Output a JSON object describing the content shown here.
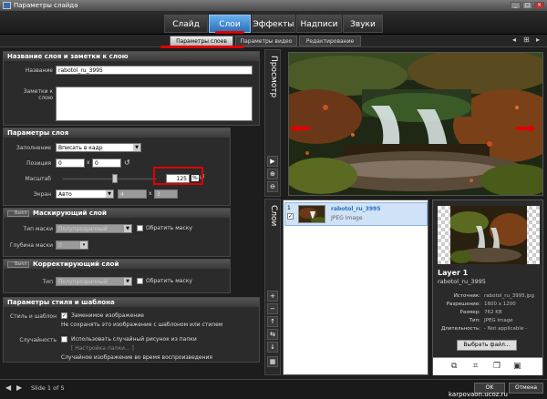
{
  "window": {
    "title": "Параметры слайда",
    "minimize_glyph": "_",
    "maximize_glyph": "□",
    "close_glyph": "×"
  },
  "main_tabs": [
    {
      "label": "Слайд"
    },
    {
      "label": "Слои"
    },
    {
      "label": "Эффекты"
    },
    {
      "label": "Надписи"
    },
    {
      "label": "Звуки"
    }
  ],
  "active_main_tab": "Слои",
  "sub_tabs": [
    {
      "label": "Параметры слоев"
    },
    {
      "label": "Параметры видео"
    },
    {
      "label": "Редактирование"
    }
  ],
  "layer_name": {
    "header": "Название слоя и заметки к слою",
    "name_label": "Название",
    "name_value": "rabotol_ru_3995",
    "notes_label": "Заметки к слою",
    "notes_value": ""
  },
  "layer_params": {
    "header": "Параметры слоя",
    "fill_label": "Заполнение",
    "fill_value": "Вписать в кадр",
    "position_label": "Позиция",
    "pos_x": "0",
    "pos_y": "0",
    "x_sep": "x",
    "scale_label": "Масштаб",
    "scale_value": "125",
    "scale_unit": "%",
    "scale_fraction": 0.55,
    "screen_label": "Экран",
    "screen_value": "Авто",
    "screen_w": "4",
    "screen_h": "3",
    "on_label": "Выкл"
  },
  "mask_layer": {
    "header": "Маскирующий слой",
    "toggle_label": "Выкл",
    "type_label": "Тип маски",
    "type_value": "Полупрозрачный",
    "invert_label": "Обратить маску",
    "depth_label": "Глубина маски",
    "depth_value": "0"
  },
  "correction_layer": {
    "header": "Корректирующий слой",
    "toggle_label": "Выкл",
    "type_label": "Тип",
    "type_value": "Полупрозрачный",
    "invert_label": "Обратить маску"
  },
  "style_params": {
    "header": "Параметры стиля и шаблона",
    "style_label": "Стиль и шаблон",
    "replaceable_label": "Заменимое изображение",
    "dont_save_label": "Не сохранять это изображение с шаблоном или стилем",
    "random_label": "Случайность",
    "use_random_label": "Использовать случайный рисунок из папки",
    "folder_settings_label": "[ Настройка папки... ]",
    "random_during_label": "Случайное изображение во время воспроизведения"
  },
  "preview": {
    "label": "Просмотр"
  },
  "layers": {
    "label": "Слои",
    "items": [
      {
        "index": "1",
        "name": "rabotol_ru_3995",
        "type": "JPEG Image"
      }
    ]
  },
  "info": {
    "layer_title": "Layer 1",
    "layer_name": "rabotol_ru_3995",
    "source_label": "Источник:",
    "source_value": "rabotol_ru_3995.jpg",
    "resolution_label": "Разрешение:",
    "resolution_value": "1600 x 1200",
    "size_label": "Размер:",
    "size_value": "762 KB",
    "type_label": "Тип:",
    "type_value": "JPEG Image",
    "duration_label": "Длительность:",
    "duration_value": "- Not applicable -",
    "choose_file_label": "Выбрать файл..."
  },
  "footer": {
    "slide_text": "Slide 1 of 5",
    "ok_label": "OK",
    "cancel_label": "Отмена",
    "watermark": "karpovaon.ucoz.ru"
  },
  "colors": {
    "accent": "#2b6fb7",
    "annotation": "#e00000"
  }
}
